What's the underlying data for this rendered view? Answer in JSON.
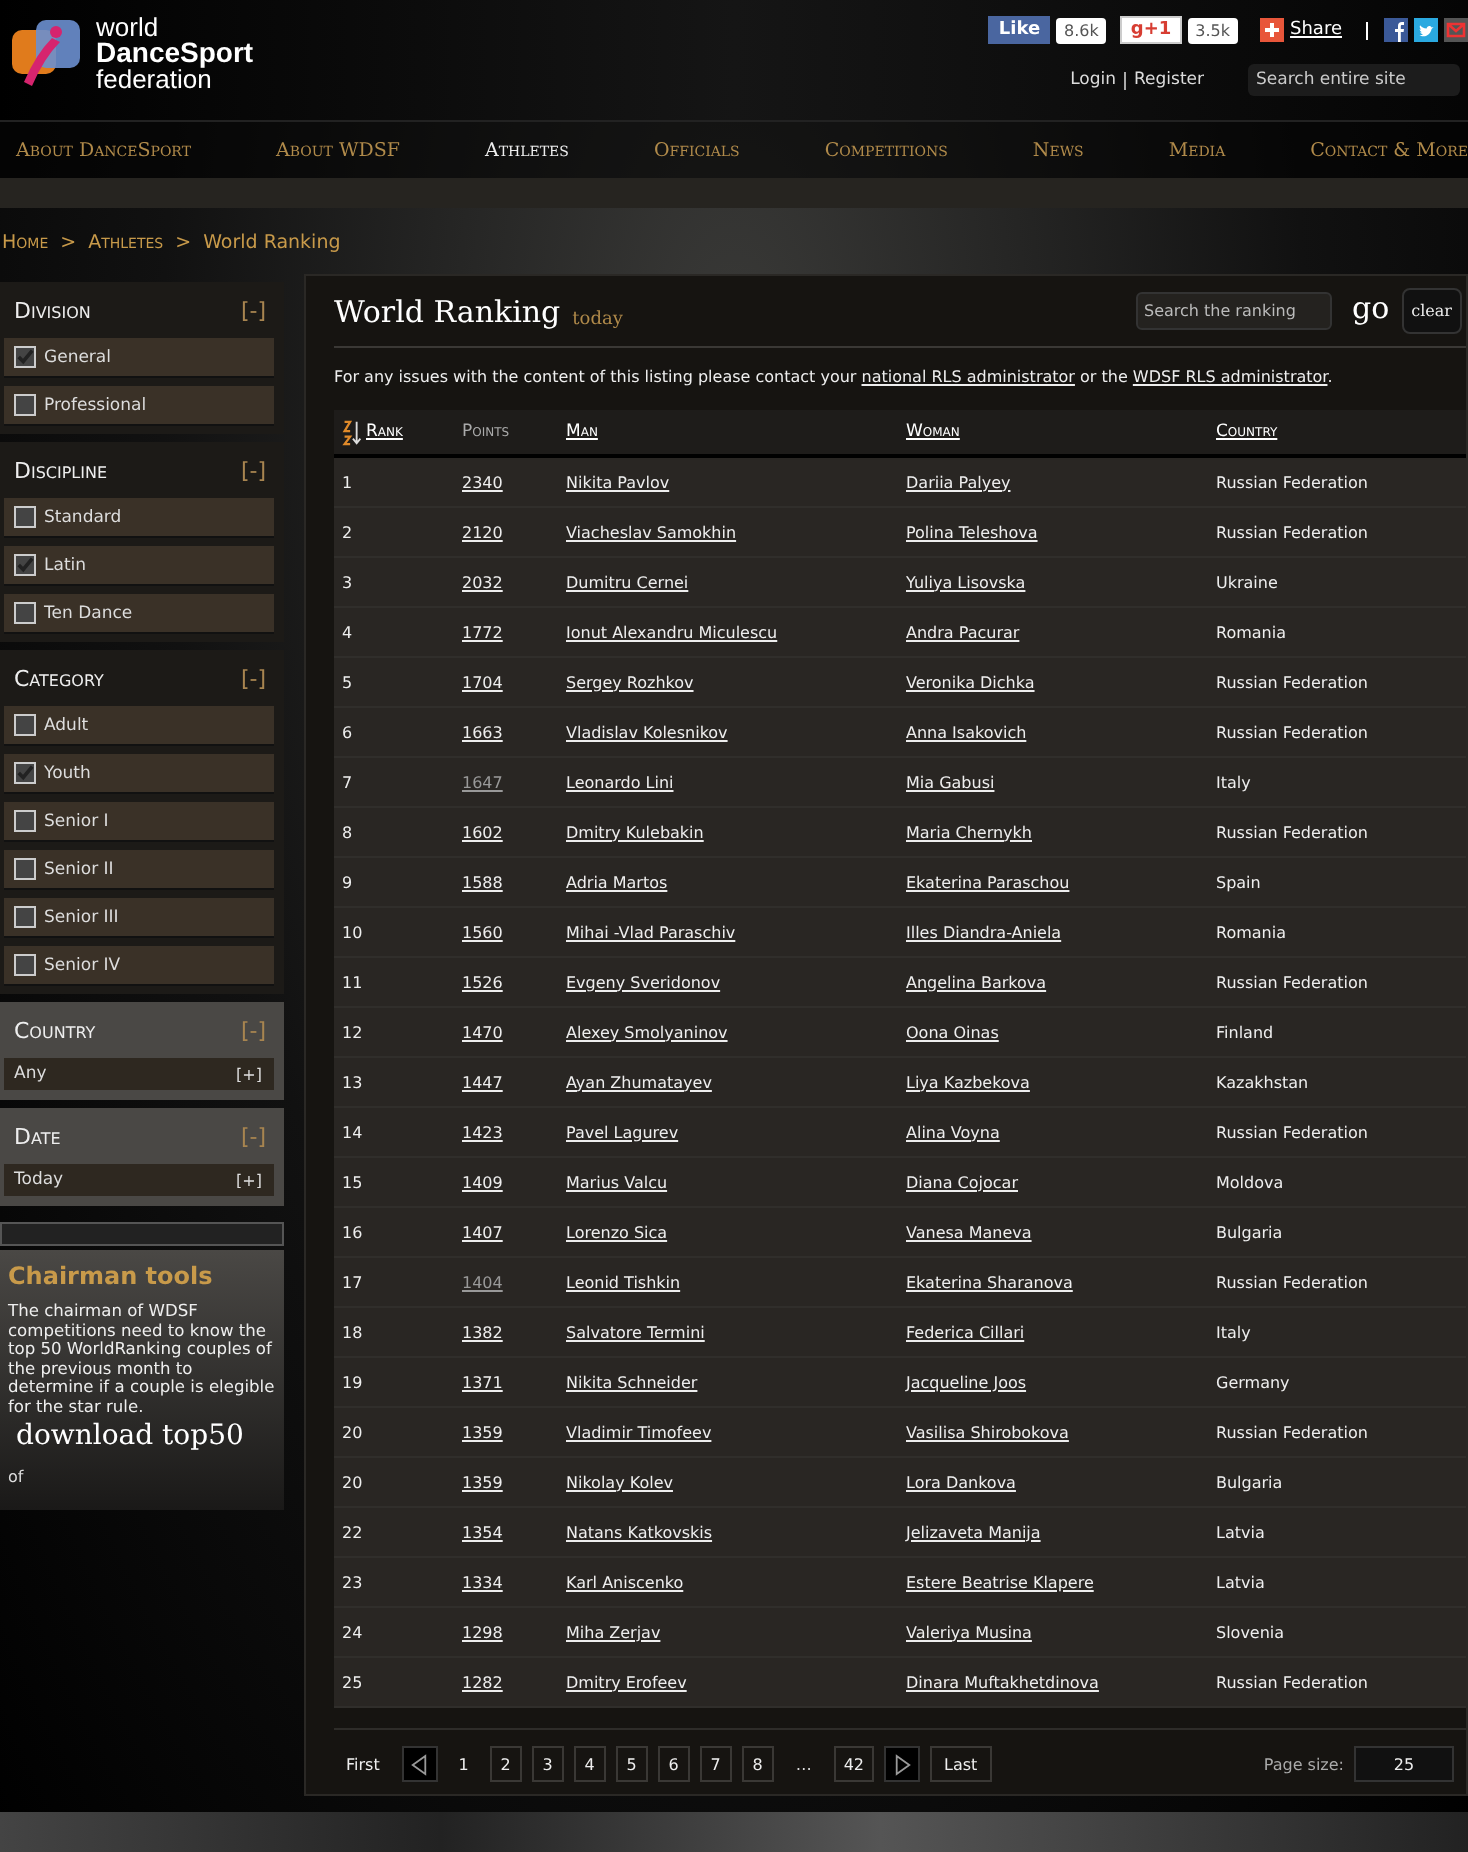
{
  "logo": {
    "lines": [
      "world",
      "DanceSport",
      "federation"
    ]
  },
  "social": {
    "like": "Like",
    "like_count": "8.6k",
    "plus": "g+1",
    "plus_count": "3.5k",
    "share": "Share"
  },
  "account": [
    "Login",
    "Register"
  ],
  "site_search": {
    "placeholder": "Search entire site"
  },
  "nav": [
    {
      "label": "About DanceSport",
      "selected": false
    },
    {
      "label": "About WDSF",
      "selected": false
    },
    {
      "label": "Athletes",
      "selected": true
    },
    {
      "label": "Officials",
      "selected": false
    },
    {
      "label": "Competitions",
      "selected": false
    },
    {
      "label": "News",
      "selected": false
    },
    {
      "label": "Media",
      "selected": false
    },
    {
      "label": "Contact & More",
      "selected": false
    }
  ],
  "breadcrumb": {
    "separator": ">",
    "items": [
      "Home",
      "Athletes",
      "World Ranking"
    ]
  },
  "sidebar": {
    "filters": [
      {
        "title": "Division",
        "toggle": "[-]",
        "kind": "checklist",
        "options": [
          {
            "label": "General",
            "checked": true
          },
          {
            "label": "Professional",
            "checked": false
          }
        ]
      },
      {
        "title": "Discipline",
        "toggle": "[-]",
        "kind": "checklist",
        "options": [
          {
            "label": "Standard",
            "checked": false
          },
          {
            "label": "Latin",
            "checked": true
          },
          {
            "label": "Ten Dance",
            "checked": false
          }
        ]
      },
      {
        "title": "Category",
        "toggle": "[-]",
        "kind": "checklist",
        "options": [
          {
            "label": "Adult",
            "checked": false
          },
          {
            "label": "Youth",
            "checked": true
          },
          {
            "label": "Senior I",
            "checked": false
          },
          {
            "label": "Senior II",
            "checked": false
          },
          {
            "label": "Senior III",
            "checked": false
          },
          {
            "label": "Senior IV",
            "checked": false
          }
        ]
      },
      {
        "title": "Country",
        "toggle": "[-]",
        "kind": "select",
        "value": "Any",
        "expand": "[+]"
      },
      {
        "title": "Date",
        "toggle": "[-]",
        "kind": "select",
        "value": "Today",
        "expand": "[+]"
      }
    ],
    "tools": {
      "title": "Chairman tools",
      "text": "The chairman of WDSF competitions need to know the top 50 WorldRanking couples of the previous month to determine if a couple is elegible for the star rule.",
      "link": "download top50",
      "trailing": "of"
    }
  },
  "ranking": {
    "title": "World Ranking",
    "subtitle": "today",
    "search": {
      "placeholder": "Search the ranking"
    },
    "go": "go",
    "clear": "clear",
    "notice": {
      "before": "For any issues with the content of this listing please contact your",
      "link1": "national RLS administrator",
      "middle": "or the",
      "link2": "WDSF RLS administrator",
      "after": "."
    },
    "columns": [
      {
        "label": "Rank",
        "link": true,
        "sorted": true
      },
      {
        "label": "Points",
        "link": false,
        "sorted": false
      },
      {
        "label": "Man",
        "link": true,
        "sorted": false
      },
      {
        "label": "Woman",
        "link": true,
        "sorted": false
      },
      {
        "label": "Country",
        "link": true,
        "sorted": false
      }
    ],
    "rows": [
      {
        "rank": "1",
        "points": "2340",
        "visited": false,
        "man": "Nikita Pavlov",
        "woman": "Dariia Palyey",
        "country": "Russian Federation"
      },
      {
        "rank": "2",
        "points": "2120",
        "visited": false,
        "man": "Viacheslav Samokhin",
        "woman": "Polina Teleshova",
        "country": "Russian Federation"
      },
      {
        "rank": "3",
        "points": "2032",
        "visited": false,
        "man": "Dumitru Cernei",
        "woman": "Yuliya Lisovska",
        "country": "Ukraine"
      },
      {
        "rank": "4",
        "points": "1772",
        "visited": false,
        "man": "Ionut Alexandru Miculescu",
        "woman": "Andra Pacurar",
        "country": "Romania"
      },
      {
        "rank": "5",
        "points": "1704",
        "visited": false,
        "man": "Sergey Rozhkov",
        "woman": "Veronika Dichka",
        "country": "Russian Federation"
      },
      {
        "rank": "6",
        "points": "1663",
        "visited": false,
        "man": "Vladislav Kolesnikov",
        "woman": "Anna Isakovich",
        "country": "Russian Federation"
      },
      {
        "rank": "7",
        "points": "1647",
        "visited": true,
        "man": "Leonardo Lini",
        "woman": "Mia Gabusi",
        "country": "Italy"
      },
      {
        "rank": "8",
        "points": "1602",
        "visited": false,
        "man": "Dmitry Kulebakin",
        "woman": "Maria Chernykh",
        "country": "Russian Federation"
      },
      {
        "rank": "9",
        "points": "1588",
        "visited": false,
        "man": "Adria Martos",
        "woman": "Ekaterina Paraschou",
        "country": "Spain"
      },
      {
        "rank": "10",
        "points": "1560",
        "visited": false,
        "man": "Mihai -Vlad Paraschiv",
        "woman": "Illes Diandra-Aniela",
        "country": "Romania"
      },
      {
        "rank": "11",
        "points": "1526",
        "visited": false,
        "man": "Evgeny Sveridonov",
        "woman": "Angelina Barkova",
        "country": "Russian Federation"
      },
      {
        "rank": "12",
        "points": "1470",
        "visited": false,
        "man": "Alexey Smolyaninov",
        "woman": "Oona Oinas",
        "country": "Finland"
      },
      {
        "rank": "13",
        "points": "1447",
        "visited": false,
        "man": "Ayan Zhumatayev",
        "woman": "Liya Kazbekova",
        "country": "Kazakhstan"
      },
      {
        "rank": "14",
        "points": "1423",
        "visited": false,
        "man": "Pavel Lagurev",
        "woman": "Alina Voyna",
        "country": "Russian Federation"
      },
      {
        "rank": "15",
        "points": "1409",
        "visited": false,
        "man": "Marius Valcu",
        "woman": "Diana Cojocar",
        "country": "Moldova"
      },
      {
        "rank": "16",
        "points": "1407",
        "visited": false,
        "man": "Lorenzo Sica",
        "woman": "Vanesa Maneva",
        "country": "Bulgaria"
      },
      {
        "rank": "17",
        "points": "1404",
        "visited": true,
        "man": "Leonid Tishkin",
        "woman": "Ekaterina Sharanova",
        "country": "Russian Federation"
      },
      {
        "rank": "18",
        "points": "1382",
        "visited": false,
        "man": "Salvatore Termini",
        "woman": "Federica Cillari",
        "country": "Italy"
      },
      {
        "rank": "19",
        "points": "1371",
        "visited": false,
        "man": "Nikita Schneider",
        "woman": "Jacqueline Joos",
        "country": "Germany"
      },
      {
        "rank": "20",
        "points": "1359",
        "visited": false,
        "man": "Vladimir Timofeev",
        "woman": "Vasilisa Shirobokova",
        "country": "Russian Federation"
      },
      {
        "rank": "20",
        "points": "1359",
        "visited": false,
        "man": "Nikolay Kolev",
        "woman": "Lora Dankova",
        "country": "Bulgaria"
      },
      {
        "rank": "22",
        "points": "1354",
        "visited": false,
        "man": "Natans Katkovskis",
        "woman": "Jelizaveta Manija",
        "country": "Latvia"
      },
      {
        "rank": "23",
        "points": "1334",
        "visited": false,
        "man": "Karl Aniscenko",
        "woman": "Estere Beatrise Klapere",
        "country": "Latvia"
      },
      {
        "rank": "24",
        "points": "1298",
        "visited": false,
        "man": "Miha Zerjav",
        "woman": "Valeriya Musina",
        "country": "Slovenia"
      },
      {
        "rank": "25",
        "points": "1282",
        "visited": false,
        "man": "Dmitry Erofeev",
        "woman": "Dinara Muftakhetdinova",
        "country": "Russian Federation"
      }
    ],
    "pagination": {
      "first": "First",
      "last": "Last",
      "ellipsis": "…",
      "pages": [
        {
          "label": "1",
          "selected": true
        },
        {
          "label": "2",
          "selected": false
        },
        {
          "label": "3",
          "selected": false
        },
        {
          "label": "4",
          "selected": false
        },
        {
          "label": "5",
          "selected": false
        },
        {
          "label": "6",
          "selected": false
        },
        {
          "label": "7",
          "selected": false
        },
        {
          "label": "8",
          "selected": false
        }
      ],
      "last_page": "42",
      "page_size_label": "Page size:",
      "page_size": "25"
    }
  }
}
